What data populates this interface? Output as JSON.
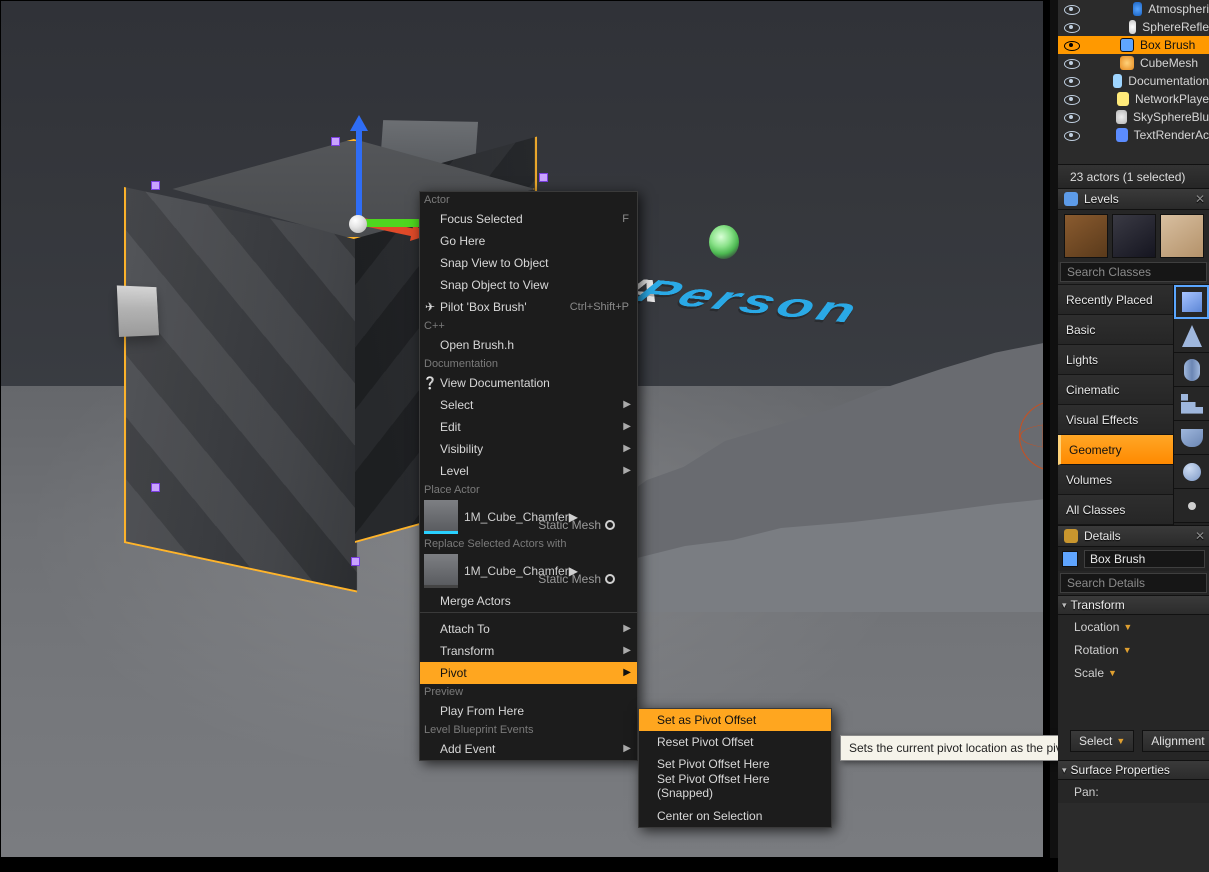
{
  "viewport": {
    "world_text": "Person",
    "world_text_a": "A"
  },
  "context_menu": {
    "h_actor": "Actor",
    "focus": "Focus Selected",
    "focus_sc": "F",
    "go_here": "Go Here",
    "snap_view_to_obj": "Snap View to Object",
    "snap_obj_to_view": "Snap Object to View",
    "pilot": "Pilot 'Box Brush'",
    "pilot_sc": "Ctrl+Shift+P",
    "h_cpp": "C++",
    "open_brush": "Open Brush.h",
    "h_doc": "Documentation",
    "view_doc": "View Documentation",
    "select": "Select",
    "edit": "Edit",
    "visibility": "Visibility",
    "level": "Level",
    "h_place": "Place Actor",
    "asset_place_name": "1M_Cube_Chamfer",
    "asset_place_type": "Static Mesh",
    "h_replace": "Replace Selected Actors with",
    "asset_replace_name": "1M_Cube_Chamfer",
    "asset_replace_type": "Static Mesh",
    "merge": "Merge Actors",
    "attach": "Attach To",
    "transform": "Transform",
    "pivot": "Pivot",
    "h_preview": "Preview",
    "play_here": "Play From Here",
    "h_lbe": "Level Blueprint Events",
    "add_event": "Add Event"
  },
  "submenu": {
    "set_offset": "Set as Pivot Offset",
    "reset_offset": "Reset Pivot Offset",
    "set_here": "Set Pivot Offset Here",
    "set_here_snap": "Set Pivot Offset Here (Snapped)",
    "center": "Center on Selection"
  },
  "tooltip": "Sets the current pivot location as the pivot offset for this actor",
  "outliner": {
    "items": [
      {
        "label": "Atmospheri",
        "cls": "ni-atm",
        "indent": true
      },
      {
        "label": "SphereRefle",
        "cls": "ni-sphere",
        "indent": true
      },
      {
        "label": "Box Brush",
        "cls": "ni-box",
        "indent": false,
        "sel": true
      },
      {
        "label": "CubeMesh",
        "cls": "ni-cube",
        "indent": false
      },
      {
        "label": "Documentation",
        "cls": "ni-doc",
        "indent": false
      },
      {
        "label": "NetworkPlaye",
        "cls": "ni-net",
        "indent": false
      },
      {
        "label": "SkySphereBlu",
        "cls": "ni-sky",
        "indent": false
      },
      {
        "label": "TextRenderAc",
        "cls": "ni-txt",
        "indent": false
      }
    ],
    "footer": "23 actors (1 selected)"
  },
  "levels": {
    "title": "Levels",
    "search_ph": "Search Classes",
    "cats": [
      "Recently Placed",
      "Basic",
      "Lights",
      "Cinematic",
      "Visual Effects",
      "Geometry",
      "Volumes",
      "All Classes"
    ],
    "selected": "Geometry"
  },
  "details": {
    "title": "Details",
    "actor_name": "Box Brush",
    "search_ph": "Search Details",
    "transform_hdr": "Transform",
    "loc": "Location",
    "rot": "Rotation",
    "scl": "Scale",
    "select_btn": "Select",
    "align_btn": "Alignment",
    "surface_hdr": "Surface Properties",
    "pan": "Pan:"
  }
}
